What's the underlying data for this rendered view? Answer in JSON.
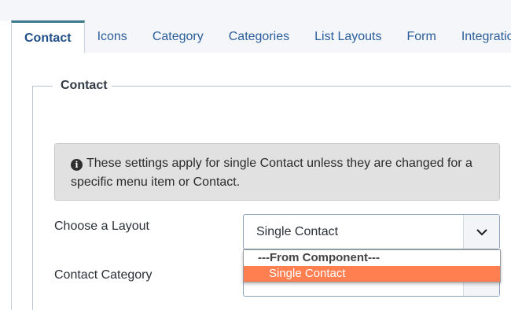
{
  "tabs": [
    {
      "label": "Contact",
      "active": true
    },
    {
      "label": "Icons",
      "active": false
    },
    {
      "label": "Category",
      "active": false
    },
    {
      "label": "Categories",
      "active": false
    },
    {
      "label": "List Layouts",
      "active": false
    },
    {
      "label": "Form",
      "active": false
    },
    {
      "label": "Integratio",
      "active": false
    }
  ],
  "fieldset": {
    "legend": "Contact",
    "alert": {
      "icon": "info-icon",
      "text": "These settings apply for single Contact unless they are changed for a specific menu item or Contact."
    },
    "layout_field": {
      "label": "Choose a Layout",
      "value": "Single Contact",
      "dropdown": {
        "group_label": "---From Component---",
        "options": [
          "Single Contact"
        ],
        "highlighted": "Single Contact"
      }
    },
    "category_field": {
      "label": "Contact Category"
    }
  },
  "colors": {
    "tab_active_border": "#3a7a8a",
    "tab_text": "#2a5d9a",
    "highlight": "#ff7f50",
    "alert_bg": "#e1e1e1"
  }
}
